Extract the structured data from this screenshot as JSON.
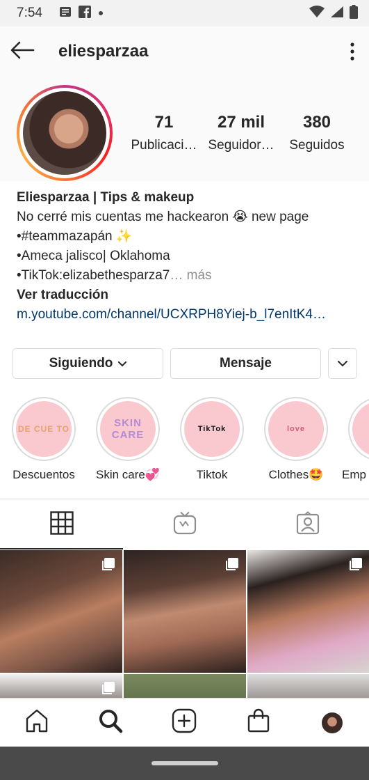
{
  "status_bar": {
    "time": "7:54",
    "left_icons": [
      "news-icon",
      "facebook-icon",
      "dot-icon"
    ],
    "right_icons": [
      "wifi-icon",
      "signal-icon",
      "battery-icon"
    ]
  },
  "header": {
    "username": "eliesparzaa",
    "back_icon": "back-arrow-icon",
    "menu_icon": "more-vertical-icon"
  },
  "profile": {
    "stats": [
      {
        "value": "71",
        "label": "Publicaci…"
      },
      {
        "value": "27 mil",
        "label": "Seguidor…"
      },
      {
        "value": "380",
        "label": "Seguidos"
      }
    ],
    "bio": {
      "name": "Eliesparzaa | Tips & makeup",
      "lines": [
        "No cerré mis cuentas me hackearon 😭 new page",
        "•#teammazapán ✨",
        "•Ameca jalisco| Oklahoma",
        "•TikTok:elizabethesparza7"
      ],
      "more": "… más",
      "translate": "Ver traducción",
      "link": "m.youtube.com/channel/UCXRPH8Yiej-b_l7enItK4…"
    }
  },
  "actions": {
    "following": "Siguiendo",
    "message": "Mensaje"
  },
  "highlights": [
    {
      "label": "Descuentos",
      "cover_text": "DE CUE TO"
    },
    {
      "label": "Skin care💞",
      "cover_text": "SKIN CARE"
    },
    {
      "label": "Tiktok",
      "cover_text": "TikTok"
    },
    {
      "label": "Clothes🤩",
      "cover_text": "love"
    },
    {
      "label": "Emp",
      "cover_text": "?"
    }
  ],
  "tabs": [
    "grid-icon",
    "igtv-icon",
    "tagged-icon"
  ],
  "bottom_nav": [
    "home-icon",
    "search-icon",
    "new-post-icon",
    "shop-icon",
    "profile-avatar"
  ],
  "colors": {
    "link": "#00376b",
    "text": "#262626",
    "muted": "#8e8e8e",
    "border": "#dbdbdb",
    "highlight_bg": "#f9c9cf"
  }
}
